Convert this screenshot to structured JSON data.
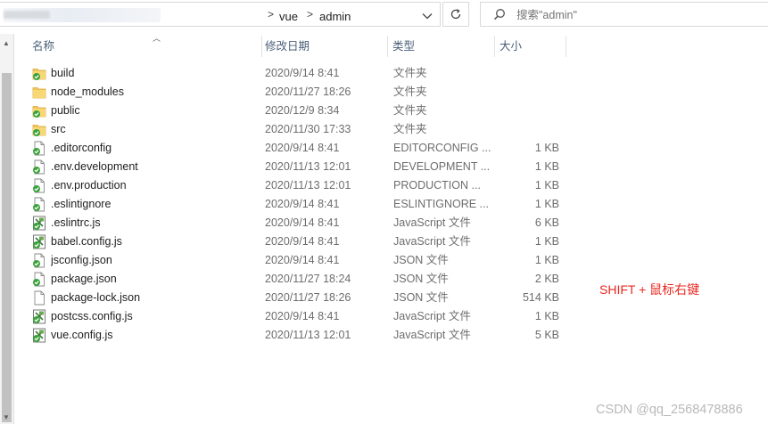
{
  "address_bar": {
    "crumbs": [
      "vue",
      "admin"
    ],
    "separator": ">"
  },
  "search": {
    "placeholder": "搜索\"admin\""
  },
  "columns": {
    "name": "名称",
    "date": "修改日期",
    "type": "类型",
    "size": "大小"
  },
  "files": [
    {
      "name": "build",
      "date": "2020/9/14 8:41",
      "type": "文件夹",
      "size": "",
      "icon": "folder-synced-icon"
    },
    {
      "name": "node_modules",
      "date": "2020/11/27 18:26",
      "type": "文件夹",
      "size": "",
      "icon": "folder-icon"
    },
    {
      "name": "public",
      "date": "2020/12/9 8:34",
      "type": "文件夹",
      "size": "",
      "icon": "folder-synced-icon"
    },
    {
      "name": "src",
      "date": "2020/11/30 17:33",
      "type": "文件夹",
      "size": "",
      "icon": "folder-synced-icon"
    },
    {
      "name": ".editorconfig",
      "date": "2020/9/14 8:41",
      "type": "EDITORCONFIG ...",
      "size": "1 KB",
      "icon": "file-synced-icon"
    },
    {
      "name": ".env.development",
      "date": "2020/11/13 12:01",
      "type": "DEVELOPMENT ...",
      "size": "1 KB",
      "icon": "file-synced-icon"
    },
    {
      "name": ".env.production",
      "date": "2020/11/13 12:01",
      "type": "PRODUCTION ...",
      "size": "1 KB",
      "icon": "file-synced-icon"
    },
    {
      "name": ".eslintignore",
      "date": "2020/9/14 8:41",
      "type": "ESLINTIGNORE ...",
      "size": "1 KB",
      "icon": "file-synced-icon"
    },
    {
      "name": ".eslintrc.js",
      "date": "2020/9/14 8:41",
      "type": "JavaScript 文件",
      "size": "6 KB",
      "icon": "js-file-synced-icon"
    },
    {
      "name": "babel.config.js",
      "date": "2020/9/14 8:41",
      "type": "JavaScript 文件",
      "size": "1 KB",
      "icon": "js-file-synced-icon"
    },
    {
      "name": "jsconfig.json",
      "date": "2020/9/14 8:41",
      "type": "JSON 文件",
      "size": "1 KB",
      "icon": "file-synced-icon"
    },
    {
      "name": "package.json",
      "date": "2020/11/27 18:24",
      "type": "JSON 文件",
      "size": "2 KB",
      "icon": "file-synced-icon"
    },
    {
      "name": "package-lock.json",
      "date": "2020/11/27 18:26",
      "type": "JSON 文件",
      "size": "514 KB",
      "icon": "file-icon"
    },
    {
      "name": "postcss.config.js",
      "date": "2020/9/14 8:41",
      "type": "JavaScript 文件",
      "size": "1 KB",
      "icon": "js-file-synced-icon"
    },
    {
      "name": "vue.config.js",
      "date": "2020/11/13 12:01",
      "type": "JavaScript 文件",
      "size": "5 KB",
      "icon": "js-file-synced-icon"
    }
  ],
  "annotation": "SHIFT + 鼠标右键",
  "watermark": "CSDN @qq_2568478886",
  "colors": {
    "annotation": "#e8271f",
    "folder": "#f2c55c",
    "sync_check": "#3aa23a"
  }
}
